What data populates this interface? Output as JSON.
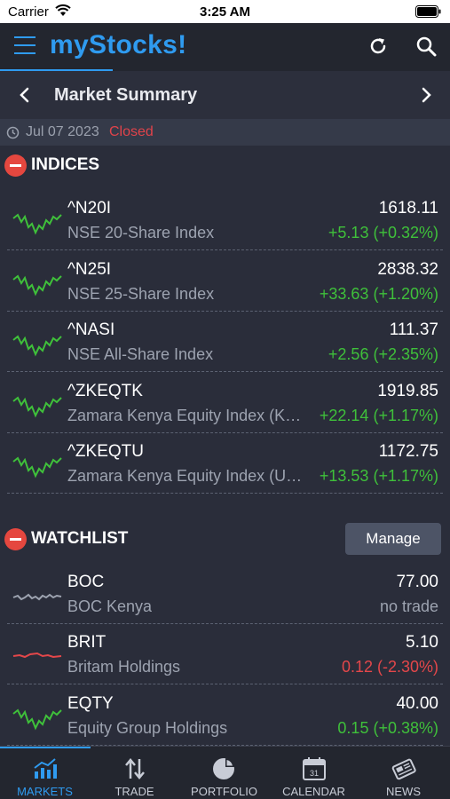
{
  "status_bar": {
    "carrier": "Carrier",
    "time": "3:25 AM"
  },
  "header": {
    "title": "myStocks!"
  },
  "summary": {
    "title": "Market Summary"
  },
  "date_bar": {
    "date": "Jul 07 2023",
    "status": "Closed"
  },
  "indices": {
    "title": "INDICES",
    "rows": [
      {
        "symbol": "^N20I",
        "name": "NSE 20-Share Index",
        "price": "1618.11",
        "change": "+5.13 (+0.32%)",
        "trend": "up",
        "color": "#3fc03a"
      },
      {
        "symbol": "^N25I",
        "name": "NSE 25-Share Index",
        "price": "2838.32",
        "change": "+33.63 (+1.20%)",
        "trend": "up",
        "color": "#3fc03a"
      },
      {
        "symbol": "^NASI",
        "name": "NSE All-Share Index",
        "price": "111.37",
        "change": "+2.56 (+2.35%)",
        "trend": "up",
        "color": "#3fc03a"
      },
      {
        "symbol": "^ZKEQTK",
        "name": "Zamara Kenya Equity Index (KES)",
        "price": "1919.85",
        "change": "+22.14 (+1.17%)",
        "trend": "up",
        "color": "#3fc03a"
      },
      {
        "symbol": "^ZKEQTU",
        "name": "Zamara Kenya Equity Index (USD)",
        "price": "1172.75",
        "change": "+13.53 (+1.17%)",
        "trend": "up",
        "color": "#3fc03a"
      }
    ]
  },
  "watchlist": {
    "title": "WATCHLIST",
    "manage_label": "Manage",
    "rows": [
      {
        "symbol": "BOC",
        "name": "BOC Kenya",
        "price": "77.00",
        "change": "no trade",
        "trend": "flat",
        "color": "#9da3b0"
      },
      {
        "symbol": "BRIT",
        "name": "Britam Holdings",
        "price": "5.10",
        "change": "0.12 (-2.30%)",
        "trend": "down",
        "color": "#e4474a"
      },
      {
        "symbol": "EQTY",
        "name": "Equity Group Holdings",
        "price": "40.00",
        "change": "0.15 (+0.38%)",
        "trend": "up",
        "color": "#3fc03a"
      }
    ]
  },
  "tabs": [
    {
      "label": "MARKETS",
      "icon": "markets-chart-icon",
      "active": true
    },
    {
      "label": "TRADE",
      "icon": "trade-arrows-icon",
      "active": false
    },
    {
      "label": "PORTFOLIO",
      "icon": "portfolio-pie-icon",
      "active": false
    },
    {
      "label": "CALENDAR",
      "icon": "calendar-icon",
      "active": false
    },
    {
      "label": "NEWS",
      "icon": "news-icon",
      "active": false
    }
  ],
  "colors": {
    "accent": "#2f9bf0",
    "positive": "#3fc03a",
    "negative": "#e4474a",
    "background": "#2a2d3a"
  }
}
